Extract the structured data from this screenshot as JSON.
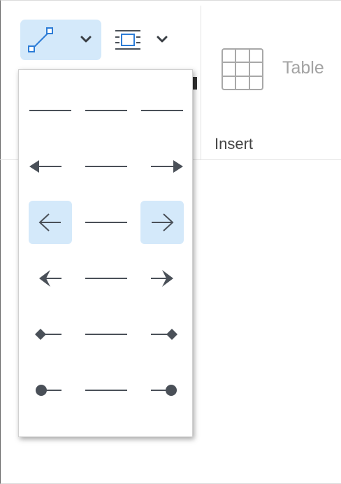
{
  "toolbar": {
    "line_style_icon": "diagonal-line-icon",
    "line_style_dropdown_icon": "chevron-down-icon",
    "text_wrap_icon": "text-wrap-icon",
    "text_wrap_dropdown_icon": "chevron-down-icon",
    "table_icon": "table-grid-icon",
    "table_label": "Table",
    "group_label": "Insert"
  },
  "line_style_menu": {
    "rows": [
      {
        "name": "plain",
        "left": "plain",
        "middle": "plain",
        "right": "plain",
        "selected": false
      },
      {
        "name": "triangle-arrow",
        "left": "triangle-arrow-left",
        "middle": "plain",
        "right": "triangle-arrow-right",
        "selected": false
      },
      {
        "name": "open-arrow",
        "left": "open-arrow-left",
        "middle": "plain",
        "right": "open-arrow-right",
        "selected": true
      },
      {
        "name": "stealth-arrow",
        "left": "stealth-arrow-left",
        "middle": "plain",
        "right": "stealth-arrow-right",
        "selected": false
      },
      {
        "name": "diamond",
        "left": "diamond-left",
        "middle": "plain",
        "right": "diamond-right",
        "selected": false
      },
      {
        "name": "oval",
        "left": "oval-left",
        "middle": "plain",
        "right": "oval-right",
        "selected": false
      }
    ]
  },
  "colors": {
    "selected_bg": "#d4e9fa",
    "icon_stroke": "#4a5058",
    "accent_blue": "#2c7cd6"
  }
}
